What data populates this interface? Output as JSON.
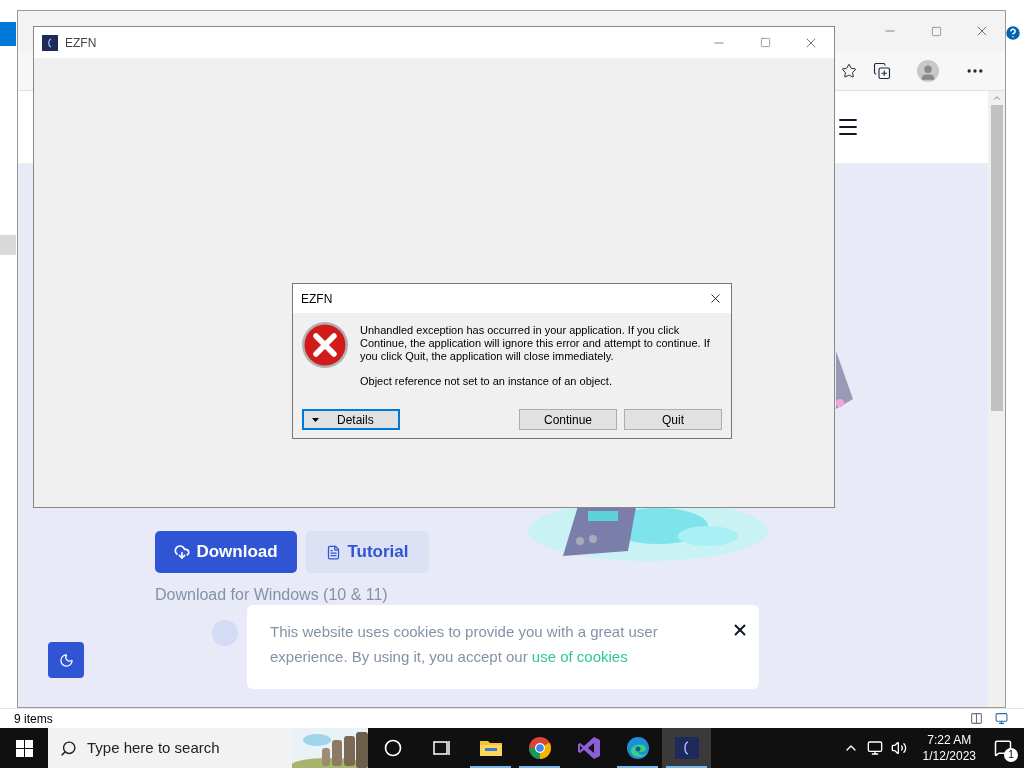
{
  "explorer": {
    "status": "9 items"
  },
  "browser": {
    "page": {
      "download_button": "Download",
      "tutorial_button": "Tutorial",
      "download_note": "Download for Windows (10 & 11)",
      "cookie_banner": {
        "text": "This website uses cookies to provide you with a great user experience. By using it, you accept our",
        "link": "use of cookies"
      }
    }
  },
  "app_window": {
    "title": "EZFN"
  },
  "dialog": {
    "title": "EZFN",
    "message": "Unhandled exception has occurred in your application. If you click Continue, the application will ignore this error and attempt to continue. If you click Quit, the application will close immediately.",
    "detail": "Object reference not set to an instance of an object.",
    "buttons": [
      {
        "label": "Details",
        "kind": "expander",
        "focused": true
      },
      {
        "label": "Continue",
        "kind": "push",
        "focused": false
      },
      {
        "label": "Quit",
        "kind": "push",
        "focused": false
      }
    ]
  },
  "taskbar": {
    "search_placeholder": "Type here to search",
    "apps": [
      {
        "kind": "cortana",
        "running": false,
        "selected": false
      },
      {
        "kind": "task-view",
        "running": false,
        "selected": false
      },
      {
        "kind": "folder",
        "running": true,
        "selected": false
      },
      {
        "kind": "chrome",
        "running": true,
        "selected": false
      },
      {
        "kind": "visual-studio",
        "running": false,
        "selected": false
      },
      {
        "kind": "edge",
        "running": true,
        "selected": false
      },
      {
        "kind": "ezfn",
        "running": true,
        "selected": true
      }
    ],
    "time": "7:22 AM",
    "date": "1/12/2023",
    "notification_count": "1"
  }
}
